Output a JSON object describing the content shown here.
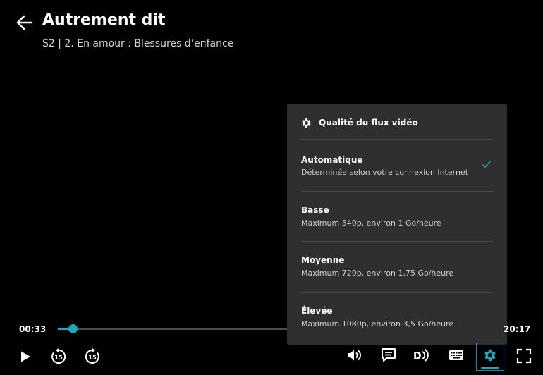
{
  "header": {
    "title": "Autrement dit",
    "subtitle": "S2  |  2. En amour : Blessures d’enfance"
  },
  "quality_panel": {
    "title": "Qualité du flux vidéo",
    "options": [
      {
        "label": "Automatique",
        "description": "Déterminée selon votre connexion Internet",
        "selected": true
      },
      {
        "label": "Basse",
        "description": "Maximum 540p, environ 1 Go/heure",
        "selected": false
      },
      {
        "label": "Moyenne",
        "description": "Maximum 720p, environ 1,75 Go/heure",
        "selected": false
      },
      {
        "label": "Élevée",
        "description": "Maximum 1080p, environ 3,5 Go/heure",
        "selected": false
      }
    ]
  },
  "player": {
    "current_time": "00:33",
    "total_time": "20:17",
    "progress_fraction": 0.027
  },
  "controls": {
    "left": [
      "play-icon",
      "rewind-15-icon",
      "forward-15-icon"
    ],
    "right": [
      "volume-icon",
      "subtitles-icon",
      "audio-description-icon",
      "keyboard-icon",
      "settings-icon",
      "fullscreen-icon"
    ]
  },
  "colors": {
    "accent": "#1fa7b8",
    "panel_bg": "#2f2f2f",
    "focus_outline": "#1e7fc8"
  }
}
